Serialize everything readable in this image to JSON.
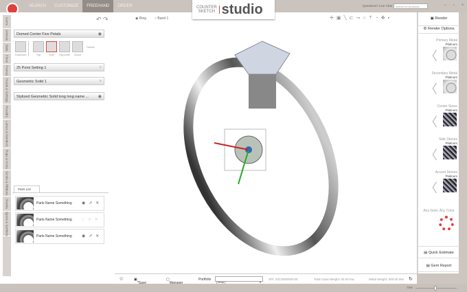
{
  "nav": {
    "items": [
      "SEARCH",
      "CUSTOMIZE",
      "FREEHAND",
      "ORDER"
    ],
    "active": "FREEHAND"
  },
  "brand": {
    "line1": "COUNTER",
    "line2": "SKETCH",
    "word": "studio"
  },
  "header": {
    "chat": "Questions? Live Chat",
    "search_placeholder": "search for products...",
    "window_controls": "– ▫ ×"
  },
  "sidebar_tabs": [
    "Gems",
    "Animals",
    "Bails",
    "Floral",
    "Frames",
    "Heads & Settings",
    "Heraldry",
    "Letters & Numbers",
    "Rope & Knots",
    "Scrolls & Ribbons",
    "Shanks",
    "Sports & Symbols"
  ],
  "layers": [
    {
      "name": "Domed Center Five Petals",
      "icon": "eye-icon"
    },
    {
      "name": "25 Point Setting 1",
      "icon": "circle-icon"
    },
    {
      "name": "Geometric Solid 1",
      "icon": "circle-icon"
    },
    {
      "name": "Stylized Geometric Solid long long name ...",
      "icon": "eye-icon"
    }
  ],
  "views": {
    "duplicate": "Duplicate",
    "top": "Top",
    "side": "Side",
    "opposite": "Opposite",
    "quad": "Quad",
    "delete": "Delete",
    "selected": "Side"
  },
  "parts": {
    "tab": "Parts List",
    "items": [
      {
        "name": "Parts Name Something",
        "visible": true
      },
      {
        "name": "Parts Name Something",
        "visible": false
      },
      {
        "name": "Parts Name Something",
        "visible": true
      }
    ]
  },
  "viewport": {
    "radio_ring": "Ring",
    "radio_band": "Band 1",
    "selected": "Ring"
  },
  "right": {
    "render": "Render",
    "render_options": "Render Options",
    "materials": [
      {
        "title": "Primary Metal",
        "value": "Platinum",
        "kind": "metal"
      },
      {
        "title": "Secondary Metal",
        "value": "Platinum",
        "kind": "metal"
      },
      {
        "title": "Center Stone",
        "value": "Platinum",
        "kind": "stone"
      },
      {
        "title": "Side Stones",
        "value": "Platinum",
        "kind": "stone"
      },
      {
        "title": "Accent Stones",
        "value": "Platinum",
        "kind": "stone"
      }
    ],
    "any_gem": "Any Gem, Any Color",
    "quick_estimate": "Quick Estimate",
    "gem_report": "Gem Report"
  },
  "bottom": {
    "save": "*Save",
    "manager": "Manager",
    "portfolio_label": "Portfolio",
    "portfolio_value": "[ temp ]",
    "spi": "SPI: 23CS000000-00",
    "carat": "Total Carat Weight: 00.00 tcw",
    "metal": "Metal Weight: 000.00 dwt"
  },
  "status": {
    "zoom": "75%"
  },
  "colors": {
    "accent": "#e0403d",
    "topbar": "#cbc3bd"
  }
}
